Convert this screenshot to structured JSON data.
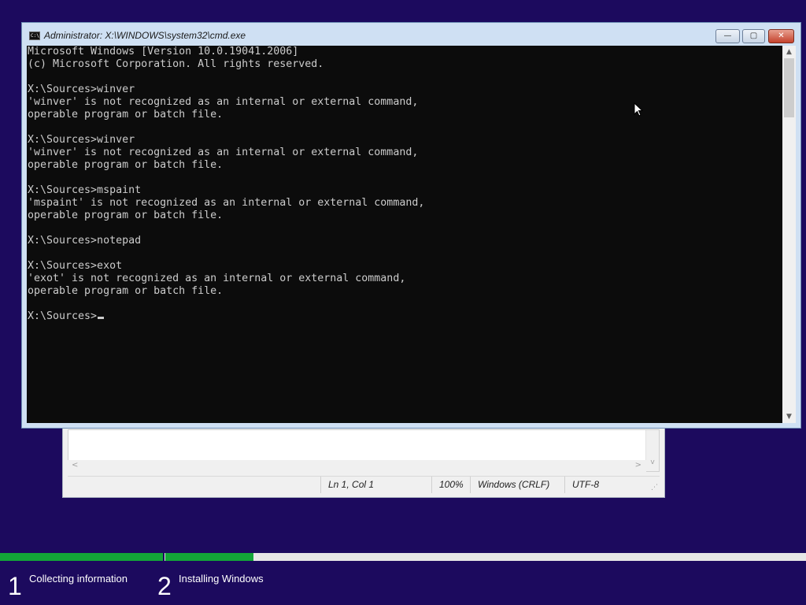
{
  "cmd": {
    "title": "Administrator: X:\\WINDOWS\\system32\\cmd.exe",
    "icon_text": "C:\\",
    "buttons": {
      "minimize": "—",
      "maximize": "▢",
      "close": "✕"
    },
    "console_text": "Microsoft Windows [Version 10.0.19041.2006]\n(c) Microsoft Corporation. All rights reserved.\n\nX:\\Sources>winver\n'winver' is not recognized as an internal or external command,\noperable program or batch file.\n\nX:\\Sources>winver\n'winver' is not recognized as an internal or external command,\noperable program or batch file.\n\nX:\\Sources>mspaint\n'mspaint' is not recognized as an internal or external command,\noperable program or batch file.\n\nX:\\Sources>notepad\n\nX:\\Sources>exot\n'exot' is not recognized as an internal or external command,\noperable program or batch file.\n\nX:\\Sources>",
    "scroll_up": "▲",
    "scroll_down": "▼"
  },
  "notepad": {
    "status": {
      "position": "Ln 1, Col 1",
      "zoom": "100%",
      "line_ending": "Windows (CRLF)",
      "encoding": "UTF-8"
    },
    "scroll_left": "<",
    "scroll_right": ">",
    "scroll_down": "v"
  },
  "setup": {
    "progress": {
      "step1_fraction": 1.0,
      "step2_fraction": 0.5
    },
    "steps": [
      {
        "number": "1",
        "label": "Collecting information"
      },
      {
        "number": "2",
        "label": "Installing Windows"
      }
    ]
  },
  "colors": {
    "background": "#1c0a5e",
    "progress_fill": "#13a538",
    "progress_track": "#e6e6e6",
    "console_bg": "#0c0c0c",
    "console_fg": "#cccccc"
  }
}
